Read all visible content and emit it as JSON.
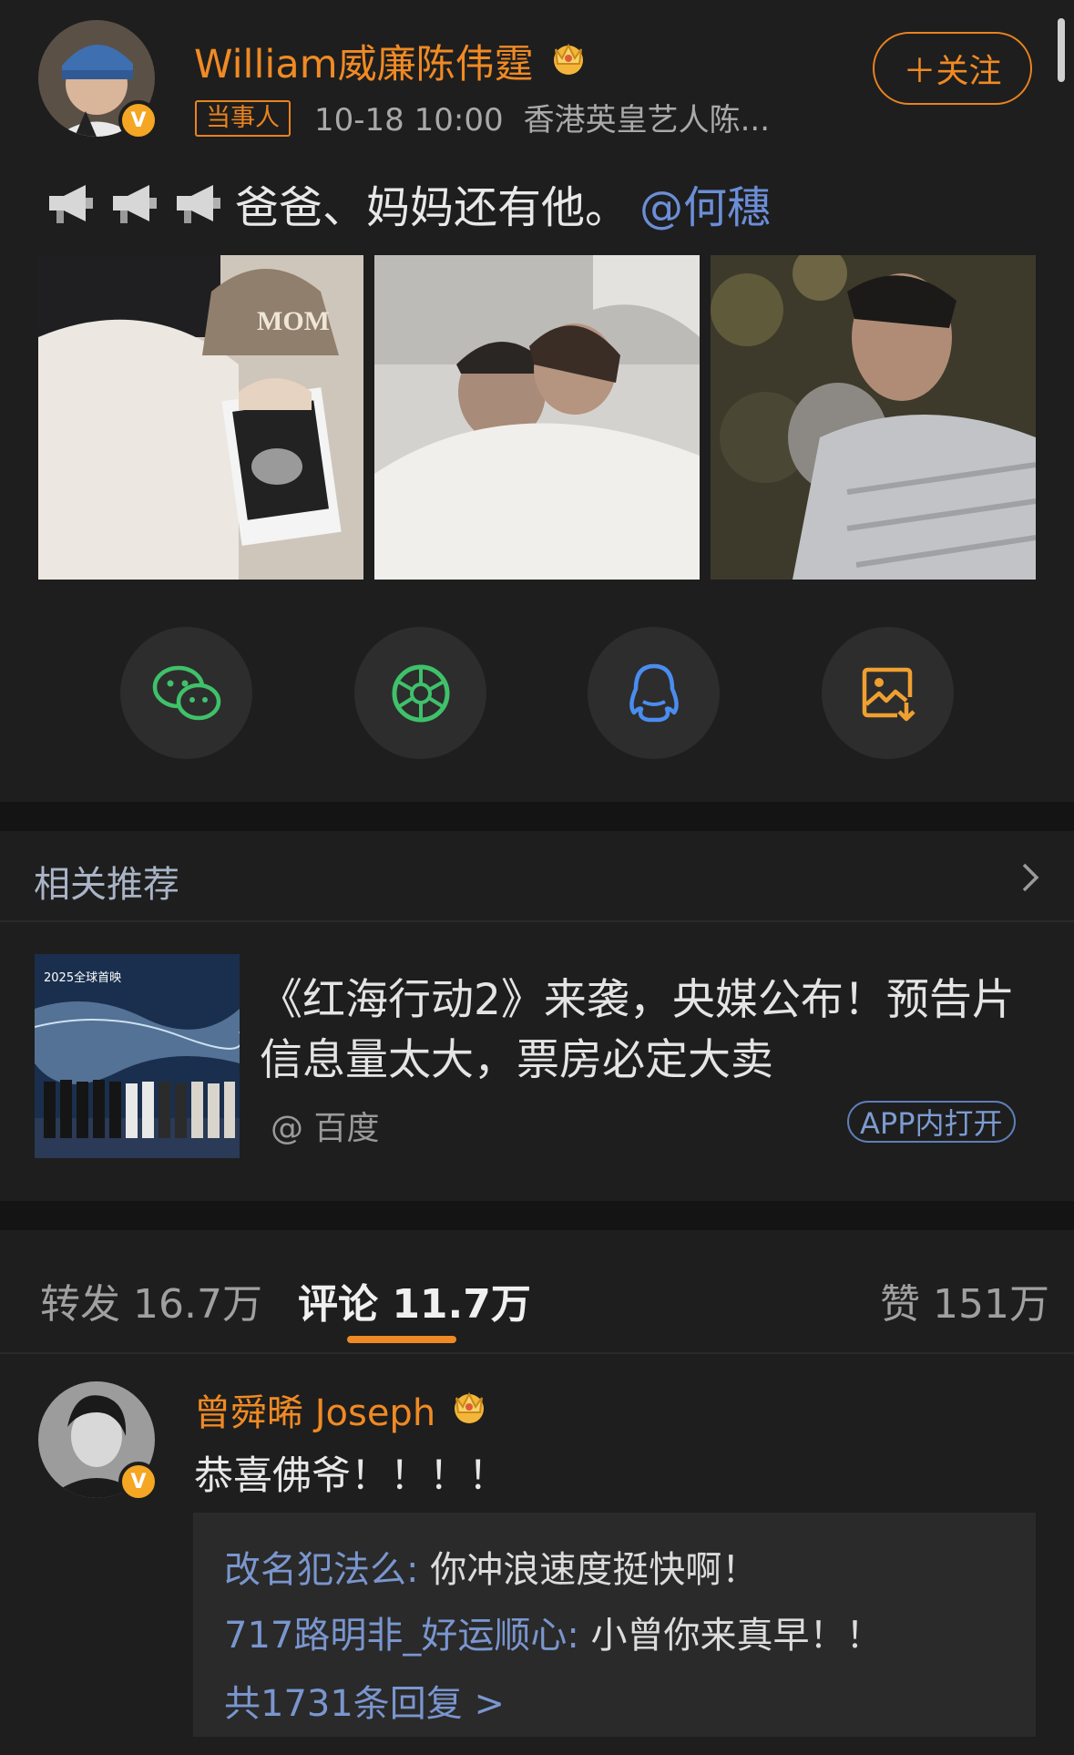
{
  "post": {
    "author": "William威廉陈伟霆",
    "tag": "当事人",
    "time": "10-18 10:00",
    "source": "香港英皇艺人陈...",
    "follow_label": "＋关注",
    "text": "爸爸、妈妈还有他。",
    "mention": "@何穗",
    "emoji_icons": [
      "megaphone-icon",
      "megaphone-icon",
      "megaphone-icon"
    ],
    "photos": [
      "couple-with-mom-cap-and-ultrasound",
      "couple-in-bed-selfie",
      "man-holding-baby"
    ]
  },
  "share": [
    "wechat-icon",
    "moments-icon",
    "qq-icon",
    "save-image-icon"
  ],
  "related": {
    "title": "相关推荐",
    "news_title": "《红海行动2》来袭，央媒公布！预告片信息量太大，票房必定大卖",
    "source": "@ 百度",
    "open_label": "APP内打开"
  },
  "tabs": {
    "repost": "转发 16.7万",
    "comment": "评论 11.7万",
    "like": "赞 151万"
  },
  "comment": {
    "author": "曾舜晞 Joseph",
    "text": "恭喜佛爷！！！！",
    "replies": [
      {
        "name": "改名犯法么:",
        "text": " 你冲浪速度挺快啊！"
      },
      {
        "name": "717路明非_好运顺心:",
        "text": " 小曾你来真早！！"
      }
    ],
    "more": "共1731条回复 >"
  },
  "colors": {
    "background": "#1e1e1e",
    "accent": "#f08a24",
    "link": "#6b8ed6",
    "band": "#141414"
  }
}
